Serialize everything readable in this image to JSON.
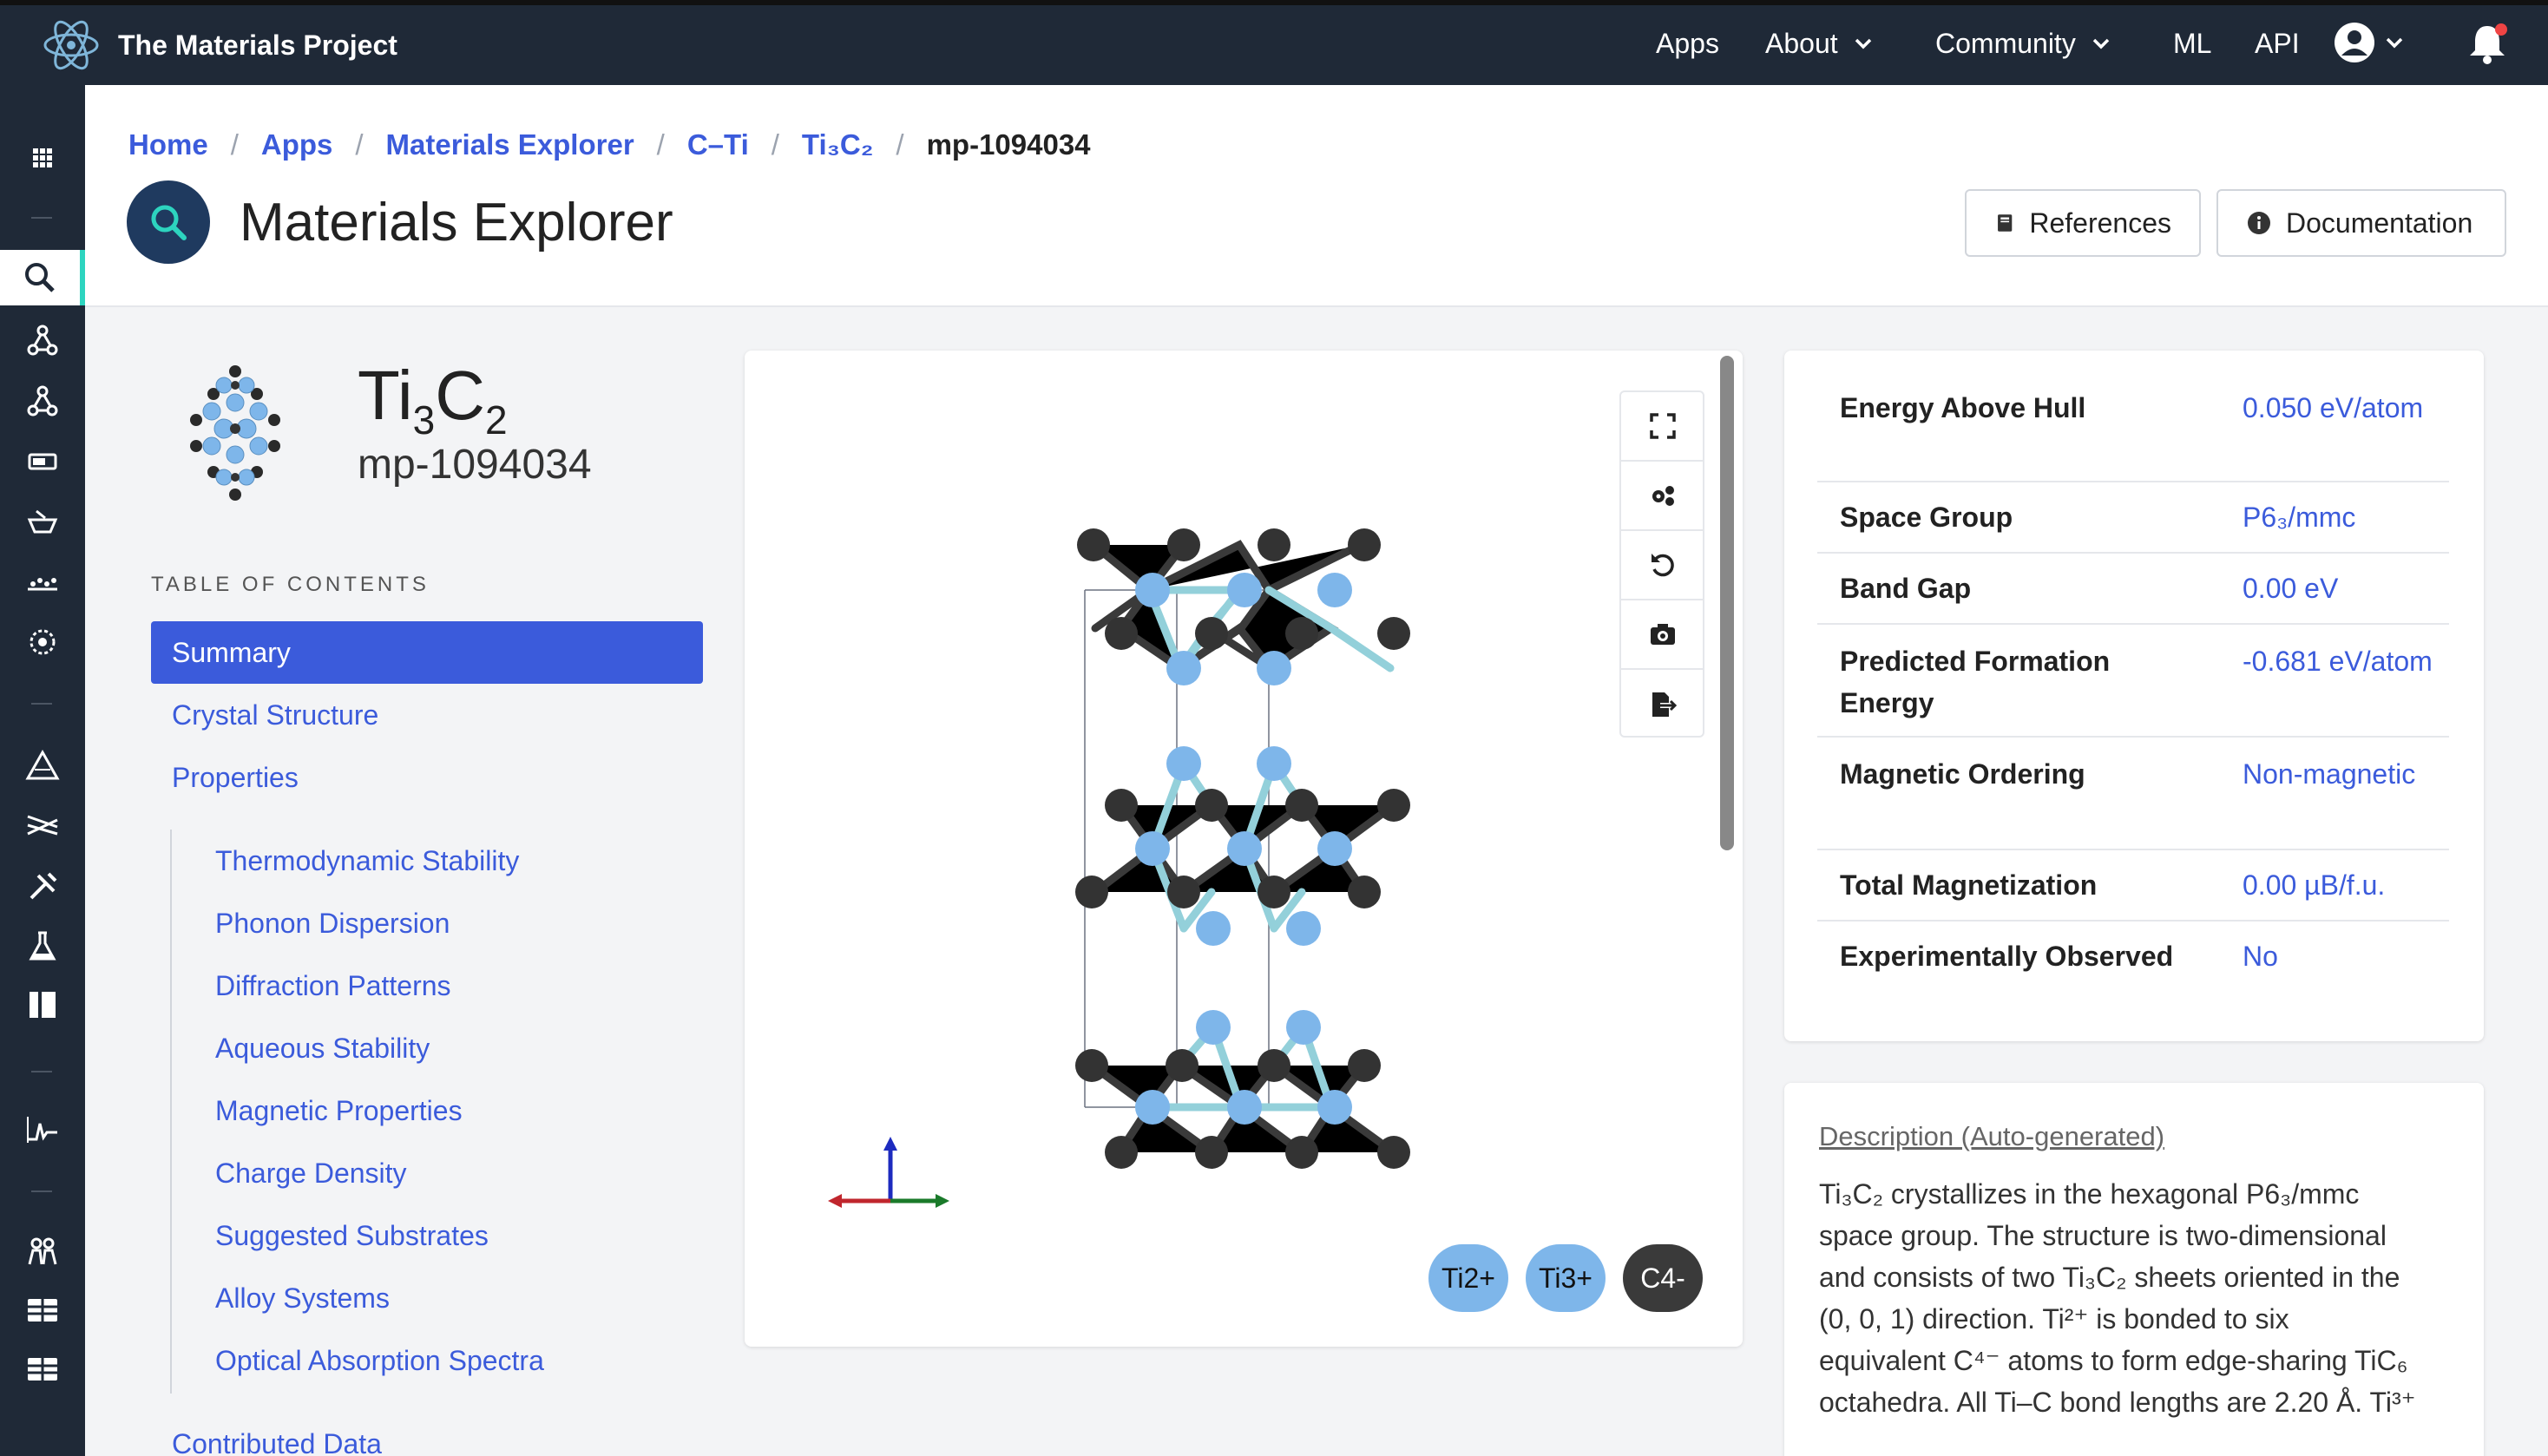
{
  "brand": {
    "title": "The Materials Project",
    "logo_icon": "atom-logo-icon"
  },
  "nav": {
    "items": [
      "Apps",
      "About",
      "Community",
      "ML",
      "API"
    ]
  },
  "breadcrumb": [
    "Home",
    "Apps",
    "Materials Explorer",
    "C–Ti",
    "Ti₃C₂",
    "mp-1094034"
  ],
  "page": {
    "title": "Materials Explorer",
    "references_label": "References",
    "documentation_label": "Documentation"
  },
  "material": {
    "formula_base": "Ti",
    "formula_sub1": "3",
    "formula_mid": "C",
    "formula_sub2": "2",
    "id": "mp-1094034"
  },
  "toc": {
    "heading": "TABLE OF CONTENTS",
    "items": [
      "Summary",
      "Crystal Structure",
      "Properties"
    ],
    "subitems": [
      "Thermodynamic Stability",
      "Phonon Dispersion",
      "Diffraction Patterns",
      "Aqueous Stability",
      "Magnetic Properties",
      "Charge Density",
      "Suggested Substrates",
      "Alloy Systems",
      "Optical Absorption Spectra"
    ],
    "last_item": "Contributed Data"
  },
  "viewer": {
    "ions": [
      "Ti2+",
      "Ti3+",
      "C4-"
    ],
    "colors": {
      "ti": "#7eb6ea",
      "c": "#3a3a3a",
      "bond_ti": "#93d0da"
    }
  },
  "properties": [
    {
      "key": "Energy Above Hull",
      "value": "0.050 eV/atom"
    },
    {
      "key": "Space Group",
      "value": "P6₃/mmc"
    },
    {
      "key": "Band Gap",
      "value": "0.00 eV"
    },
    {
      "key": "Predicted Formation Energy",
      "value": "-0.681 eV/atom"
    },
    {
      "key": "Magnetic Ordering",
      "value": "Non-magnetic"
    },
    {
      "key": "Total Magnetization",
      "value": "0.00 µB/f.u."
    },
    {
      "key": "Experimentally Observed",
      "value": "No"
    }
  ],
  "description": {
    "title": "Description (Auto-generated)",
    "lines": [
      "Ti₃C₂ crystallizes in the hexagonal P6₃/mmc",
      "space group. The structure is two-dimensional",
      "and consists of two Ti₃C₂ sheets oriented in the",
      "(0, 0, 1) direction. Ti²⁺ is bonded to six",
      "equivalent C⁴⁻ atoms to form edge-sharing TiC₆",
      "octahedra. All Ti–C bond lengths are 2.20 Å. Ti³⁺"
    ]
  },
  "accent": "#3b5bdb"
}
